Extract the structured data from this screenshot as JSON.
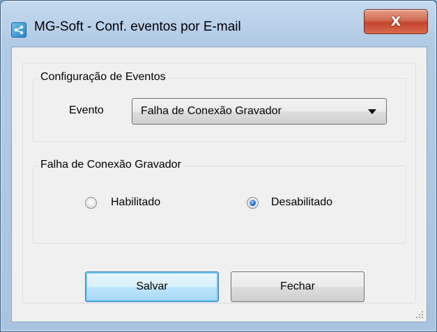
{
  "window": {
    "title": "MG-Soft - Conf. eventos por E-mail",
    "close_label": "X",
    "app_icon": "share-icon"
  },
  "config_group": {
    "legend": "Configuração de Eventos",
    "event_label": "Evento",
    "event_selected": "Falha de Conexão Gravador"
  },
  "event_group": {
    "legend": "Falha de Conexão Gravador",
    "options": [
      {
        "label": "Habilitado",
        "checked": false
      },
      {
        "label": "Desabilitado",
        "checked": true
      }
    ]
  },
  "buttons": {
    "save_label": "Salvar",
    "close_label": "Fechar"
  },
  "colors": {
    "accent": "#3c7fb1",
    "close_button": "#c4452d"
  }
}
